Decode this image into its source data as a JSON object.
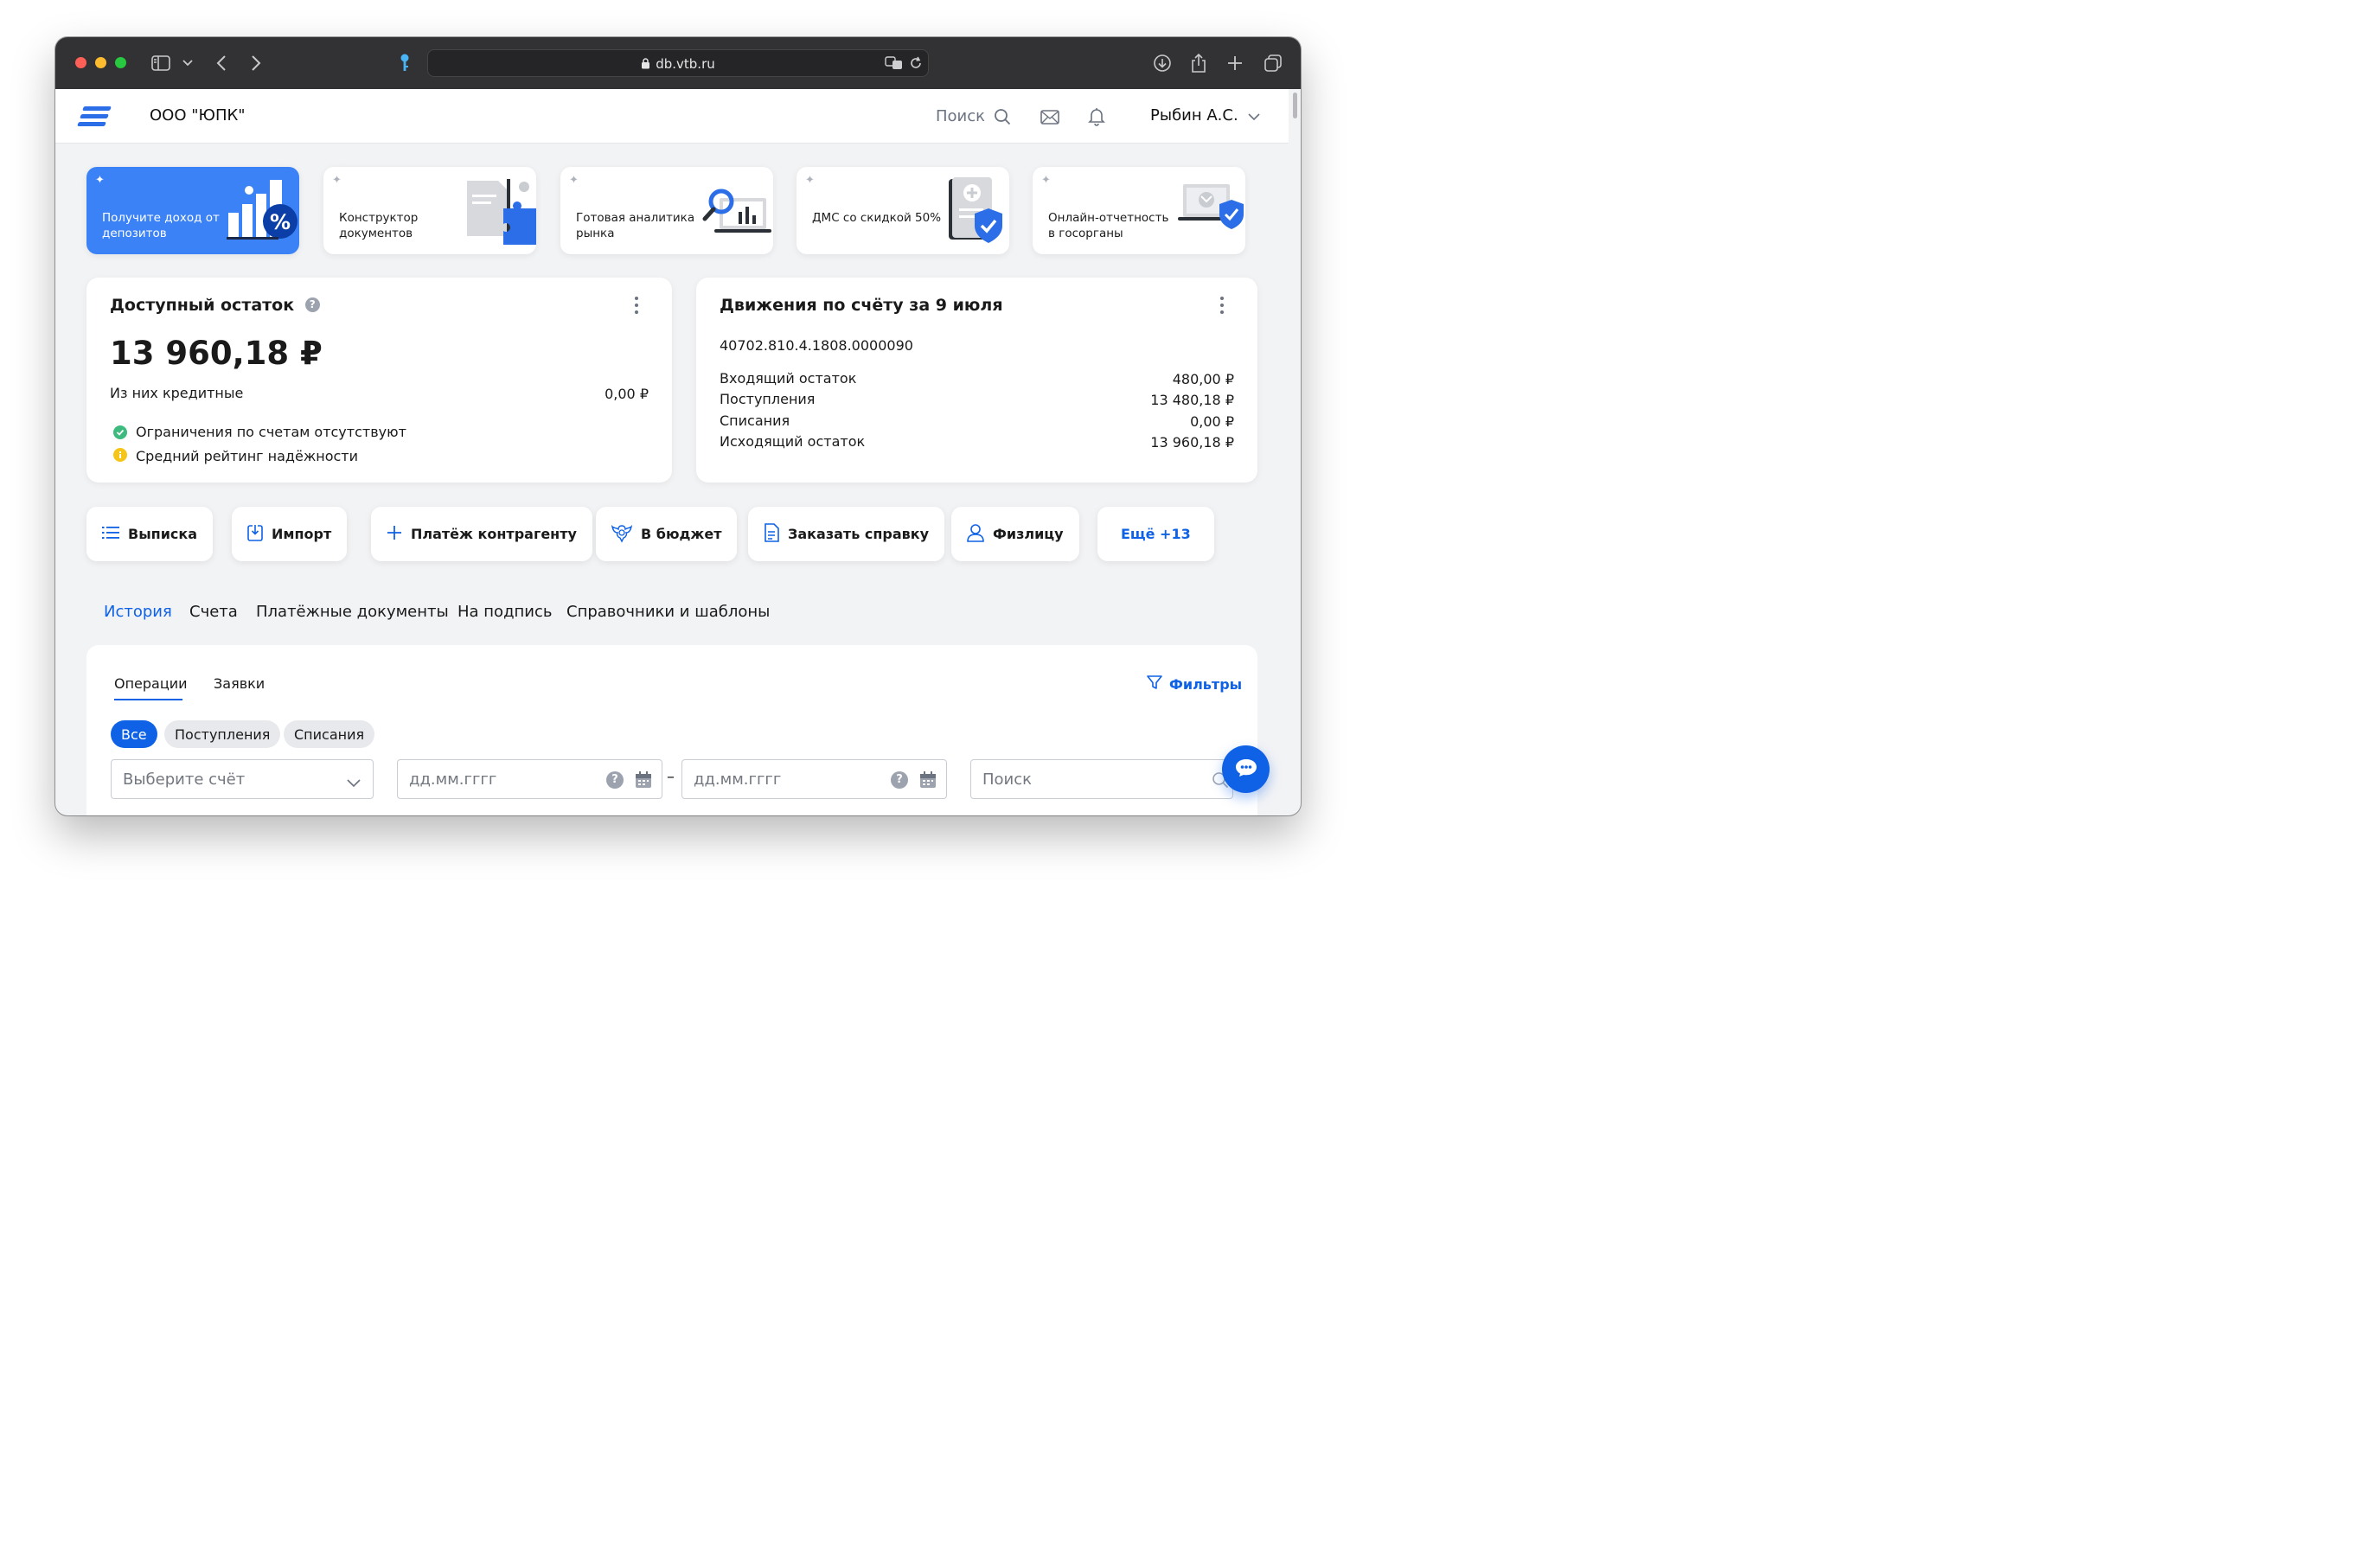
{
  "browser": {
    "url": "db.vtb.ru"
  },
  "header": {
    "company": "ООО \"ЮПК\"",
    "search_label": "Поиск",
    "user_name": "Рыбин А.С."
  },
  "promos": [
    {
      "label": "Получите доход от депозитов"
    },
    {
      "label": "Конструктор документов"
    },
    {
      "label": "Готовая аналитика рынка"
    },
    {
      "label": "ДМС со скидкой 50%"
    },
    {
      "label": "Онлайн-отчетность в госорганы"
    }
  ],
  "balance": {
    "title": "Доступный остаток",
    "amount": "13 960,18 ₽",
    "credit_label": "Из них кредитные",
    "credit_value": "0,00 ₽",
    "status_ok": "Ограничения по счетам отсутствуют",
    "status_warn": "Средний рейтинг надёжности"
  },
  "movements": {
    "title": "Движения по счёту за 9 июля",
    "account": "40702.810.4.1808.0000090",
    "rows": [
      {
        "label": "Входящий остаток",
        "value": "480,00 ₽"
      },
      {
        "label": "Поступления",
        "value": "13 480,18 ₽"
      },
      {
        "label": "Списания",
        "value": "0,00 ₽"
      },
      {
        "label": "Исходящий остаток",
        "value": "13 960,18 ₽"
      }
    ]
  },
  "actions": {
    "statement": "Выписка",
    "import": "Импорт",
    "payment": "Платёж контрагенту",
    "budget": "В бюджет",
    "certificate": "Заказать справку",
    "individual": "Физлицу",
    "more": "Ещё +13"
  },
  "main_tabs": [
    "История",
    "Счета",
    "Платёжные документы",
    "На подпись",
    "Справочники и шаблоны"
  ],
  "history": {
    "subtabs": [
      "Операции",
      "Заявки"
    ],
    "filters_label": "Фильтры",
    "chips": [
      "Все",
      "Поступления",
      "Списания"
    ],
    "account_placeholder": "Выберите счёт",
    "date_from_placeholder": "дд.мм.гггг",
    "date_separator": "–",
    "date_to_placeholder": "дд.мм.гггг",
    "search_placeholder": "Поиск"
  },
  "colors": {
    "accent": "#0f62e6",
    "promo_blue": "#3b82f6",
    "ok": "#3dbb7e",
    "warn": "#f5c518"
  }
}
